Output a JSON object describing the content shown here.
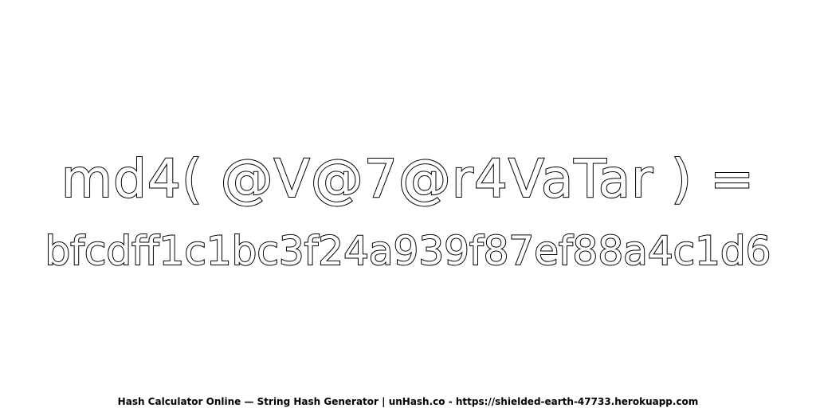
{
  "expression": "md4( @V@7@r4VaTar ) =",
  "hash_value": "bfcdff1c1bc3f24a939f87ef88a4c1d6",
  "footer": "Hash Calculator Online — String Hash Generator | unHash.co - https://shielded-earth-47733.herokuapp.com"
}
